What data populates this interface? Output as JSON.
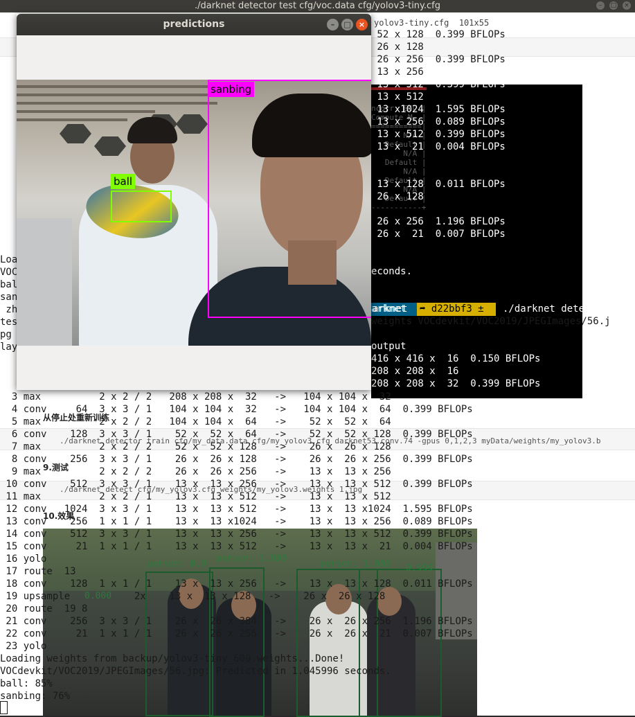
{
  "terminal": {
    "title": "./darknet detector test cfg/voc.data cfg/yolov3-tiny.cfg",
    "controls": {
      "minimize": "–",
      "maximize": "□",
      "close": "×"
    },
    "tab_caption": "yolov3-tiny.cfg  101x55"
  },
  "background_doc": {
    "code_line_1": "./darknet detector train cfg/my_data.data cfg/my_yolov3.cfg darknet53.conv.74 -gpus 0,1,2,3",
    "heading_resume": "从停止处重新训练",
    "code_resume": "./darknet detector train cfg/my_data.data cfg/my_yolov3.cfg darknet53.conv.74 -gpus 0,1,2,3 myData/weights/my_yolov3.b",
    "heading_test": "9.测试",
    "code_test": "./darknet detect cfg/my_yolov3.cfg weights/my_yolov3.weights 1.jpg",
    "heading_effect": "10.效果"
  },
  "nvidia_smi_ghost": [
    "ncorr. ECC |",
    "Compute M. |",
    "===========|",
    "       N/A |",
    "   Default |",
    "       N/A |",
    "   Default |",
    "       N/A |",
    "   Default |",
    "       N/A |",
    "   Default |",
    "-----------+"
  ],
  "right_column_lines": [
    {
      "row": 0,
      "text": " 52 x 128  0.399 BFLOPs"
    },
    {
      "row": 1,
      "text": " 26 x 128"
    },
    {
      "row": 2,
      "text": " 26 x 256  0.399 BFLOPs"
    },
    {
      "row": 3,
      "text": " 13 x 256"
    },
    {
      "row": 4,
      "text": " 13 x 512  0.399 BFLOPs"
    },
    {
      "row": 5,
      "text": " 13 x 512"
    },
    {
      "row": 6,
      "text": " 13 x1024  1.595 BFLOPs"
    },
    {
      "row": 7,
      "text": " 13 x 256  0.089 BFLOPs"
    },
    {
      "row": 8,
      "text": " 13 x 512  0.399 BFLOPs"
    },
    {
      "row": 9,
      "text": " 13 x  21  0.004 BFLOPs"
    },
    {
      "row": 12,
      "text": " 13 x 128  0.011 BFLOPs"
    },
    {
      "row": 13,
      "text": " 26 x 128"
    },
    {
      "row": 15,
      "text": " 26 x 256  1.196 BFLOPs"
    },
    {
      "row": 16,
      "text": " 26 x  21  0.007 BFLOPs"
    },
    {
      "row": 19,
      "text": "econds."
    },
    {
      "row": 22,
      "text": "arknet"
    },
    {
      "row": 23,
      "text": "weights VOCdevkit/VOC2019/JPEGImages/56.j"
    },
    {
      "row": 25,
      "text": "output"
    },
    {
      "row": 26,
      "text": "416 x 416 x  16  0.150 BFLOPs"
    },
    {
      "row": 27,
      "text": "208 x 208 x  16"
    },
    {
      "row": 28,
      "text": "208 x 208 x  32  0.399 BFLOPs"
    }
  ],
  "prompt": {
    "segment_dir": "arknet",
    "segment_git": "➦ d22bbf3 ±",
    "command": "./darknet detector t"
  },
  "left_fragments": [
    "Load",
    "VOC",
    "ball",
    "san",
    " zh",
    "test",
    "pg",
    "lay"
  ],
  "layer_table": [
    "  3 max          2 x 2 / 2   208 x 208 x  32   ->   104 x 104 x  32",
    "  4 conv     64  3 x 3 / 1   104 x 104 x  32   ->   104 x 104 x  64  0.399 BFLOPs",
    "  5 max          2 x 2 / 2   104 x 104 x  64   ->    52 x  52 x  64",
    "  6 conv    128  3 x 3 / 1    52 x  52 x  64   ->    52 x  52 x 128  0.399 BFLOPs",
    "  7 max          2 x 2 / 2    52 x  52 x 128   ->    26 x  26 x 128",
    "  8 conv    256  3 x 3 / 1    26 x  26 x 128   ->    26 x  26 x 256  0.399 BFLOPs",
    "  9 max          2 x 2 / 2    26 x  26 x 256   ->    13 x  13 x 256",
    " 10 conv    512  3 x 3 / 1    13 x  13 x 256   ->    13 x  13 x 512  0.399 BFLOPs",
    " 11 max          2 x 2 / 1    13 x  13 x 512   ->    13 x  13 x 512",
    " 12 conv   1024  3 x 3 / 1    13 x  13 x 512   ->    13 x  13 x1024  1.595 BFLOPs",
    " 13 conv    256  1 x 1 / 1    13 x  13 x1024   ->    13 x  13 x 256  0.089 BFLOPs",
    " 14 conv    512  3 x 3 / 1    13 x  13 x 256   ->    13 x  13 x 512  0.399 BFLOPs",
    " 15 conv     21  1 x 1 / 1    13 x  13 x 512   ->    13 x  13 x  21  0.004 BFLOPs",
    " 16 yolo",
    " 17 route  13",
    " 18 conv    128  1 x 1 / 1    13 x  13 x 256   ->    13 x  13 x 128  0.011 BFLOPs",
    " 19 upsample           2x    13 x  13 x 128   ->    26 x  26 x 128",
    " 20 route  19 8",
    " 21 conv    256  3 x 3 / 1    26 x  26 x 384   ->    26 x  26 x 256  1.196 BFLOPs",
    " 22 conv     21  1 x 1 / 1    26 x  26 x 256   ->    26 x  26 x  21  0.007 BFLOPs",
    " 23 yolo",
    "Loading weights from backup/yolov3-tiny_600.weights...Done!",
    "VOCdevkit/VOC2019/JPEGImages/56.jpg: Predicted in 1.045996 seconds.",
    "ball: 85%",
    "sanbing: 76%"
  ],
  "street_labels": [
    "person: 0.9",
    "person: 1.000",
    "person: 1.000",
    "0.999",
    "0.000"
  ],
  "predictions_window": {
    "title": "predictions",
    "controls": {
      "minimize": "–",
      "maximize": "□",
      "close": "×"
    },
    "detections": [
      {
        "label": "sanbing",
        "color": "#ff00ff"
      },
      {
        "label": "ball",
        "color": "#80ff00"
      }
    ]
  },
  "colors": {
    "terminal_bg": "#ffffff",
    "prompt_dir_bg": "#005f87",
    "prompt_git_bg": "#d7af00",
    "close_button": "#e95420"
  }
}
